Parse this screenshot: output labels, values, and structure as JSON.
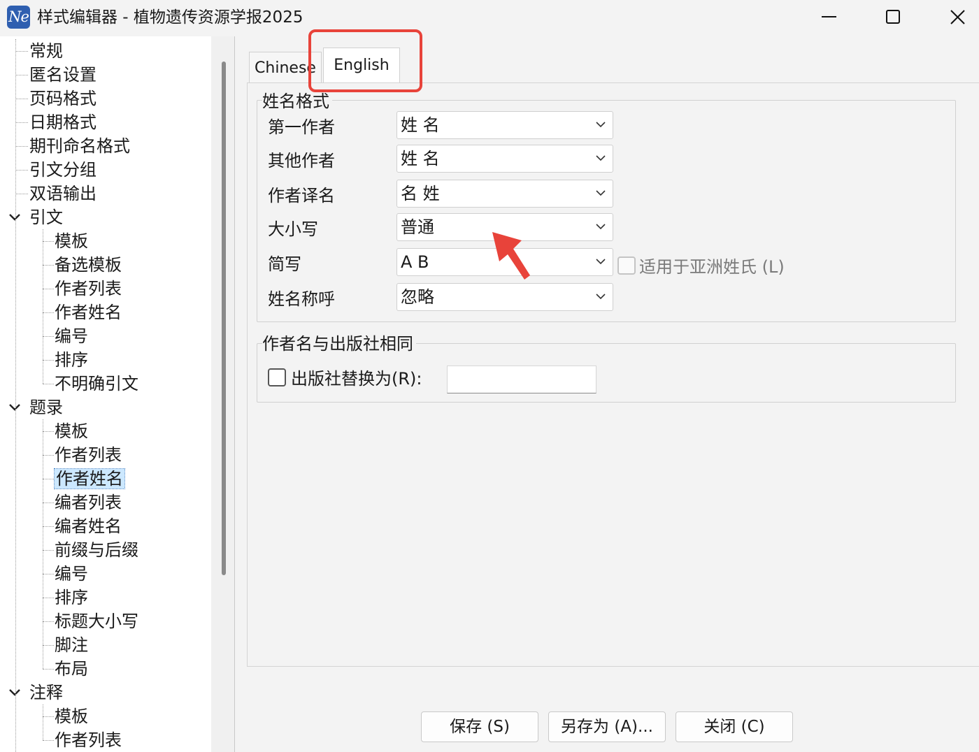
{
  "window": {
    "app_icon_text": "Ne",
    "title": "样式编辑器 - 植物遗传资源学报2025"
  },
  "tree": [
    {
      "label": "常规"
    },
    {
      "label": "匿名设置"
    },
    {
      "label": "页码格式"
    },
    {
      "label": "日期格式"
    },
    {
      "label": "期刊命名格式"
    },
    {
      "label": "引文分组"
    },
    {
      "label": "双语输出"
    },
    {
      "label": "引文",
      "children": [
        {
          "label": "模板"
        },
        {
          "label": "备选模板"
        },
        {
          "label": "作者列表"
        },
        {
          "label": "作者姓名"
        },
        {
          "label": "编号"
        },
        {
          "label": "排序"
        },
        {
          "label": "不明确引文"
        }
      ]
    },
    {
      "label": "题录",
      "children": [
        {
          "label": "模板"
        },
        {
          "label": "作者列表"
        },
        {
          "label": "作者姓名",
          "selected": true
        },
        {
          "label": "编者列表"
        },
        {
          "label": "编者姓名"
        },
        {
          "label": "前缀与后缀"
        },
        {
          "label": "编号"
        },
        {
          "label": "排序"
        },
        {
          "label": "标题大小写"
        },
        {
          "label": "脚注"
        },
        {
          "label": "布局"
        }
      ]
    },
    {
      "label": "注释",
      "children": [
        {
          "label": "模板"
        },
        {
          "label": "作者列表"
        }
      ]
    }
  ],
  "tabs": [
    {
      "label": "Chinese",
      "active": false
    },
    {
      "label": "English",
      "active": true
    }
  ],
  "name_format": {
    "legend": "姓名格式",
    "rows": [
      {
        "label": "第一作者",
        "value": "姓 名"
      },
      {
        "label": "其他作者",
        "value": "姓 名"
      },
      {
        "label": "作者译名",
        "value": "名 姓"
      },
      {
        "label": "大小写",
        "value": "普通"
      },
      {
        "label": "简写",
        "value": "A B"
      },
      {
        "label": "姓名称呼",
        "value": "忽略"
      }
    ],
    "asian_checkbox": {
      "label": "适用于亚洲姓氏 (L)",
      "checked": false,
      "disabled": true
    }
  },
  "publisher": {
    "legend": "作者名与出版社相同",
    "checkbox_label": "出版社替换为(R):",
    "checked": false,
    "value": ""
  },
  "buttons": {
    "save": "保存 (S)",
    "save_as": "另存为 (A)...",
    "close": "关闭 (C)"
  },
  "annotation": {
    "highlight_color": "#e8433a",
    "arrow_color": "#e8433a"
  }
}
